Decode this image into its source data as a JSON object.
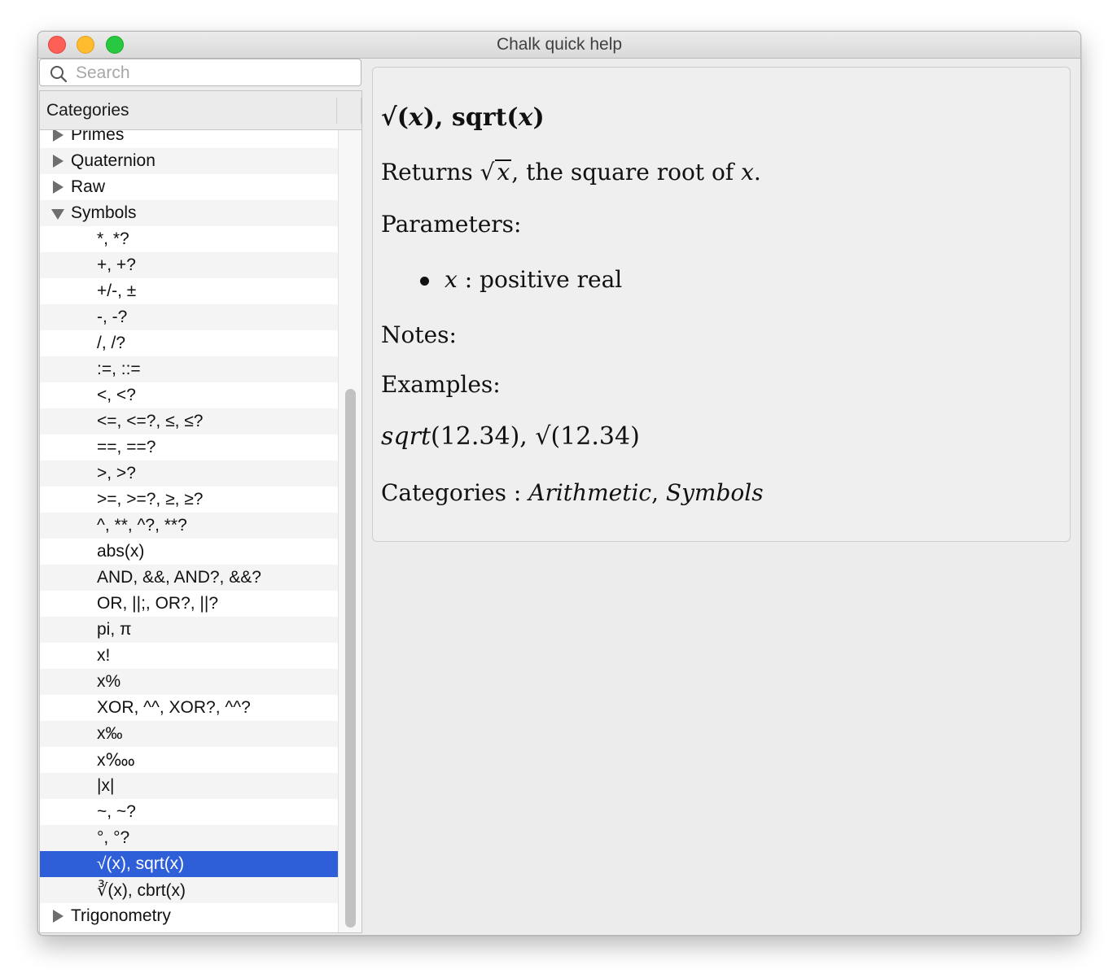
{
  "window": {
    "title": "Chalk quick help"
  },
  "search": {
    "placeholder": "Search",
    "value": ""
  },
  "list": {
    "header": "Categories",
    "rows": [
      {
        "kind": "category",
        "label": "Primes",
        "expanded": false
      },
      {
        "kind": "category",
        "label": "Quaternion",
        "expanded": false
      },
      {
        "kind": "category",
        "label": "Raw",
        "expanded": false
      },
      {
        "kind": "category",
        "label": "Symbols",
        "expanded": true
      },
      {
        "kind": "item",
        "label": "*, *?"
      },
      {
        "kind": "item",
        "label": "+, +?"
      },
      {
        "kind": "item",
        "label": "+/-, ±"
      },
      {
        "kind": "item",
        "label": "-, -?"
      },
      {
        "kind": "item",
        "label": "/, /?"
      },
      {
        "kind": "item",
        "label": ":=, ::="
      },
      {
        "kind": "item",
        "label": "<, <?"
      },
      {
        "kind": "item",
        "label": "<=, <=?, ≤, ≤?"
      },
      {
        "kind": "item",
        "label": "==, ==?"
      },
      {
        "kind": "item",
        "label": ">, >?"
      },
      {
        "kind": "item",
        "label": ">=, >=?, ≥, ≥?"
      },
      {
        "kind": "item",
        "label": "^, **, ^?, **?"
      },
      {
        "kind": "item",
        "label": "abs(x)"
      },
      {
        "kind": "item",
        "label": "AND, &&, AND?, &&?"
      },
      {
        "kind": "item",
        "label": "OR, ||;, OR?, ||?"
      },
      {
        "kind": "item",
        "label": "pi, π"
      },
      {
        "kind": "item",
        "label": "x!"
      },
      {
        "kind": "item",
        "label": "x%"
      },
      {
        "kind": "item",
        "label": "XOR, ^^, XOR?, ^^?"
      },
      {
        "kind": "item",
        "label": "x‰"
      },
      {
        "kind": "item",
        "label": "x‱"
      },
      {
        "kind": "item",
        "label": "|x|"
      },
      {
        "kind": "item",
        "label": "~, ~?"
      },
      {
        "kind": "item",
        "label": "°, °?"
      },
      {
        "kind": "item",
        "label": "√(x), sqrt(x)",
        "selected": true
      },
      {
        "kind": "item",
        "label": "∛(x), cbrt(x)"
      },
      {
        "kind": "category",
        "label": "Trigonometry",
        "expanded": false
      }
    ]
  },
  "doc": {
    "title_sym": "√(",
    "title_var": "x",
    "title_mid": "), sqrt(",
    "title_var2": "x",
    "title_end": ")",
    "returns_prefix": "Returns ",
    "returns_radical": "√",
    "returns_var": "x",
    "returns_suffix": ", the square root of ",
    "returns_var2": "x",
    "returns_end": ".",
    "parameters_heading": "Parameters:",
    "param_var": "x",
    "param_desc": " : positive real",
    "notes_heading": "Notes:",
    "examples_heading": "Examples:",
    "example_fn": "sqrt",
    "example_rest": "(12.34), √(12.34)",
    "categories_prefix": "Categories : ",
    "category_1": "Arithmetic",
    "category_sep": ", ",
    "category_2": "Symbols"
  }
}
